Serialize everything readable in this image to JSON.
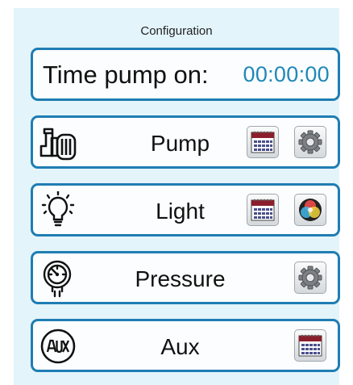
{
  "header": {
    "title": "Configuration"
  },
  "timer": {
    "label": "Time pump on:",
    "value": "00:00:00"
  },
  "rows": [
    {
      "label": "Pump",
      "icon": "pump-icon",
      "buttons": [
        "calendar-icon",
        "gear-icon"
      ]
    },
    {
      "label": "Light",
      "icon": "lightbulb-icon",
      "buttons": [
        "calendar-icon",
        "color-wheel-icon"
      ]
    },
    {
      "label": "Pressure",
      "icon": "pressure-gauge-icon",
      "buttons": [
        "gear-icon"
      ]
    },
    {
      "label": "Aux",
      "icon": "aux-icon",
      "buttons": [
        "calendar-icon"
      ]
    }
  ],
  "colors": {
    "accent": "#1f7db3",
    "panel_bg": "#e3f4fb",
    "timer_value": "#1f88b8"
  }
}
